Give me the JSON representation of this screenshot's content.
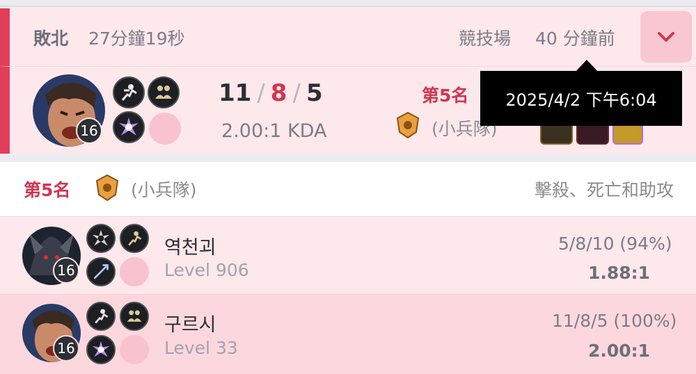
{
  "match": {
    "result": "敗北",
    "duration": "27分鐘19秒",
    "mode": "競技場",
    "time_ago": "40 分鐘前",
    "expand_icon": "chevron-down-icon",
    "tooltip": "2025/4/2 下午6:04"
  },
  "summary": {
    "level": "16",
    "kills": "11",
    "deaths": "8",
    "assists": "5",
    "sep": "/",
    "kda_ratio": "2.00:1 KDA",
    "rank": "第5名",
    "tier": "(小兵隊)"
  },
  "team": {
    "rank": "第5名",
    "tier": "(小兵隊)",
    "column_label": "擊殺、死亡和助攻"
  },
  "players": [
    {
      "name": "역천괴",
      "level_text": "Level 906",
      "champ_level": "16",
      "kda": "5/8/10 (94%)",
      "ratio": "1.88:1"
    },
    {
      "name": "구르시",
      "level_text": "Level 33",
      "champ_level": "16",
      "kda": "11/8/5 (100%)",
      "ratio": "2.00:1"
    }
  ],
  "colors": {
    "loss": "#e23d5b",
    "accent": "#d13651",
    "row_bg": "#fde8ec",
    "row_highlight": "#fcd7de"
  }
}
